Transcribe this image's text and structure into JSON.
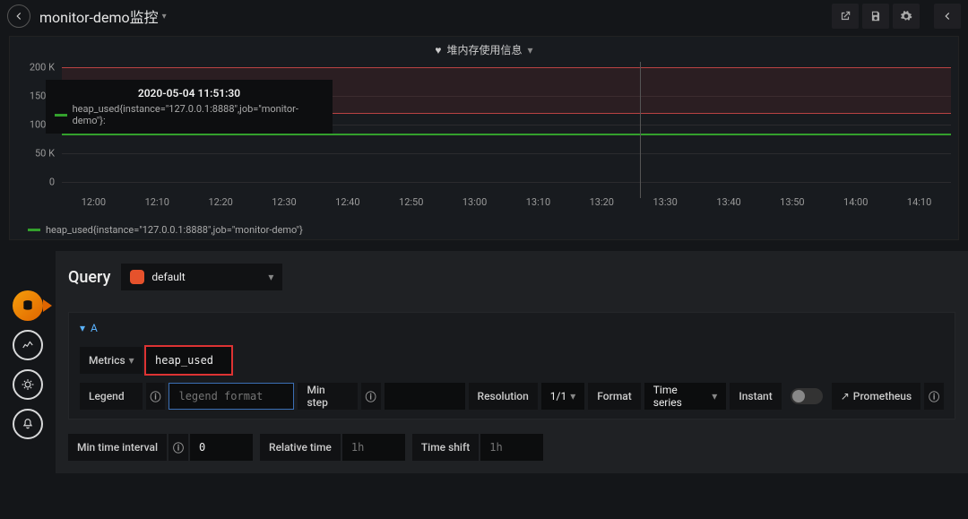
{
  "header": {
    "dashboard_title": "monitor-demo监控"
  },
  "panel": {
    "title": "堆内存使用信息",
    "tooltip_time": "2020-05-04 11:51:30",
    "tooltip_series": "heap_used{instance=\"127.0.0.1:8888\",job=\"monitor-demo\"}:",
    "legend_text": "heap_used{instance=\"127.0.0.1:8888\",job=\"monitor-demo\"}"
  },
  "chart_data": {
    "type": "line",
    "title": "堆内存使用信息",
    "xlabel": "",
    "ylabel": "",
    "ylim": [
      0,
      220000
    ],
    "x_ticks": [
      "12:00",
      "12:10",
      "12:20",
      "12:30",
      "12:40",
      "12:50",
      "13:00",
      "13:10",
      "13:20",
      "13:30",
      "13:40",
      "13:50",
      "14:00",
      "14:10"
    ],
    "y_ticks": [
      0,
      50000,
      100000,
      150000,
      200000
    ],
    "y_tick_labels": [
      "0",
      "50 K",
      "100 K",
      "150 K",
      "200 K"
    ],
    "series": [
      {
        "name": "heap_used{instance=\"127.0.0.1:8888\",job=\"monitor-demo\"}",
        "color": "#33a02c",
        "values": [
          100000,
          100000,
          100000,
          100000,
          100000,
          100000,
          100000,
          100000,
          100000,
          100000,
          100000,
          100000,
          100000,
          100000
        ]
      }
    ],
    "threshold_band": {
      "from": 130000,
      "to": 200000,
      "color": "#8a2a2a"
    }
  },
  "editor": {
    "query_label": "Query",
    "datasource": "default",
    "row_letter": "A",
    "labels": {
      "metrics": "Metrics",
      "legend": "Legend",
      "min_step": "Min step",
      "resolution": "Resolution",
      "format": "Format",
      "instant": "Instant",
      "prometheus": "Prometheus",
      "min_time_interval": "Min time interval",
      "relative_time": "Relative time",
      "time_shift": "Time shift"
    },
    "values": {
      "metrics": "heap_used",
      "legend_placeholder": "legend format",
      "min_step": "",
      "resolution": "1/1",
      "format": "Time series",
      "min_time_interval": "0",
      "relative_time_placeholder": "1h",
      "time_shift_placeholder": "1h"
    }
  }
}
